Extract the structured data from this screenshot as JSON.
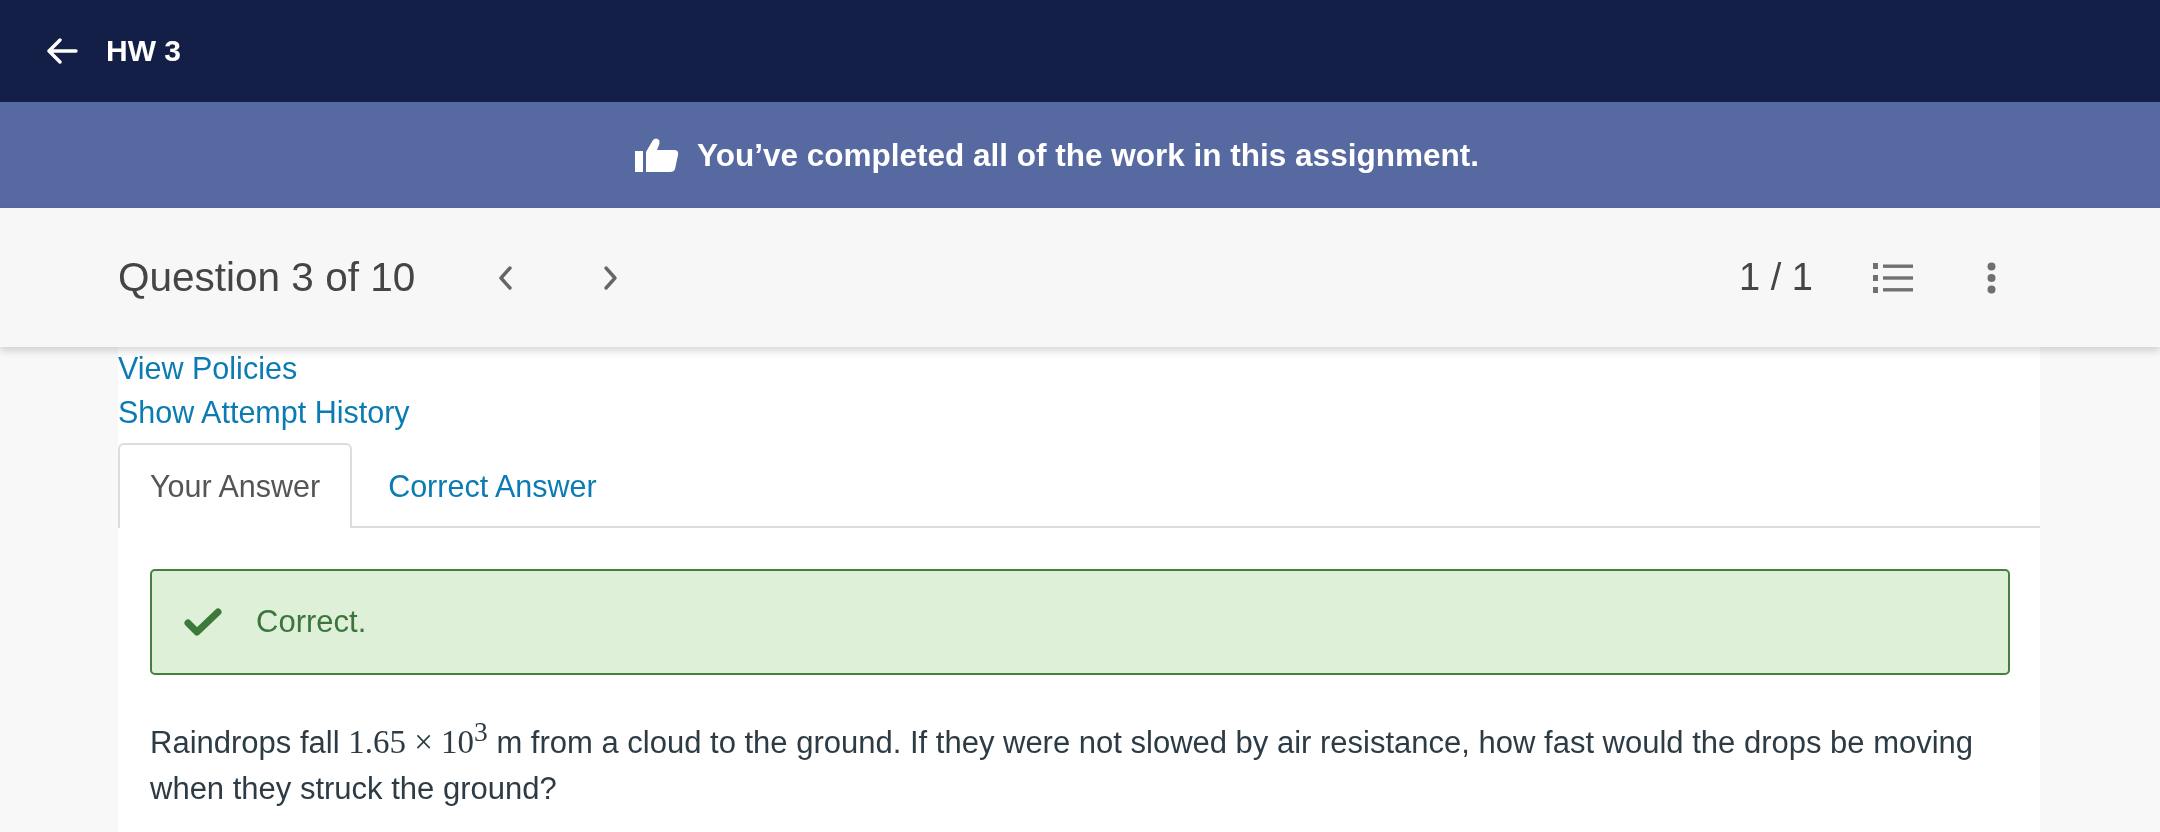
{
  "top_bar": {
    "title": "HW 3"
  },
  "banner": {
    "message": "You’ve completed all of the work in this assignment."
  },
  "question_bar": {
    "label": "Question 3 of 10",
    "page_counter": "1 / 1"
  },
  "links": [
    "View Policies",
    "Show Attempt History"
  ],
  "tabs": [
    {
      "label": "Your Answer",
      "selected": true
    },
    {
      "label": "Correct Answer",
      "selected": false
    }
  ],
  "feedback": {
    "kind": "correct",
    "message": "Correct."
  },
  "question": {
    "segments": [
      {
        "kind": "text",
        "text": "Raindrops fall "
      },
      {
        "kind": "math",
        "text": "1.65 × 10$^{3}$"
      },
      {
        "kind": "text",
        "text": " m from a cloud to the ground. If they were not slowed by air resistance, how fast would the drops be moving when they struck the ground?"
      }
    ]
  }
}
